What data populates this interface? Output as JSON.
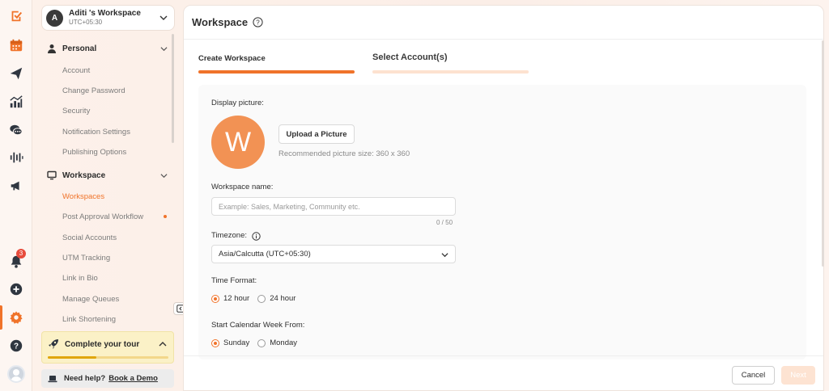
{
  "rail": {
    "icons": [
      "logo-icon",
      "calendar-icon",
      "send-icon",
      "analytics-icon",
      "chat-icon",
      "listening-icon",
      "megaphone-icon",
      "bell-icon",
      "plus-icon",
      "gear-icon",
      "help-icon",
      "user-avatar"
    ],
    "notification_count": "3",
    "accent": "#f0732a"
  },
  "workspace_switcher": {
    "initial": "A",
    "name": "Aditi 's Workspace",
    "timezone": "UTC+05:30"
  },
  "sidebar": {
    "personal_label": "Personal",
    "personal_items": [
      "Account",
      "Change Password",
      "Security",
      "Notification Settings",
      "Publishing Options"
    ],
    "workspace_label": "Workspace",
    "workspace_items": [
      "Workspaces",
      "Post Approval Workflow",
      "Social Accounts",
      "UTM Tracking",
      "Link in Bio",
      "Manage Queues",
      "Link Shortening"
    ],
    "active_item": "Workspaces"
  },
  "tour": {
    "title": "Complete your tour",
    "progress": 0.4
  },
  "help": {
    "text": "Need help?",
    "link": "Book a Demo"
  },
  "main": {
    "title": "Workspace",
    "steps": [
      "Create Workspace",
      "Select Account(s)"
    ],
    "display_picture_label": "Display picture:",
    "picture_initial": "W",
    "upload_button": "Upload a Picture",
    "picture_hint": "Recommended picture size: 360 x 360",
    "workspace_name_label": "Workspace name:",
    "workspace_name_placeholder": "Example: Sales, Marketing, Community etc.",
    "workspace_name_value": "",
    "char_counter": "0 / 50",
    "timezone_label": "Timezone:",
    "timezone_value": "Asia/Calcutta (UTC+05:30)",
    "time_format_label": "Time Format:",
    "time_format_options": [
      "12 hour",
      "24 hour"
    ],
    "time_format_selected": "12 hour",
    "week_start_label": "Start Calendar Week From:",
    "week_start_options": [
      "Sunday",
      "Monday"
    ],
    "week_start_selected": "Sunday",
    "cancel_button": "Cancel",
    "next_button": "Next"
  }
}
